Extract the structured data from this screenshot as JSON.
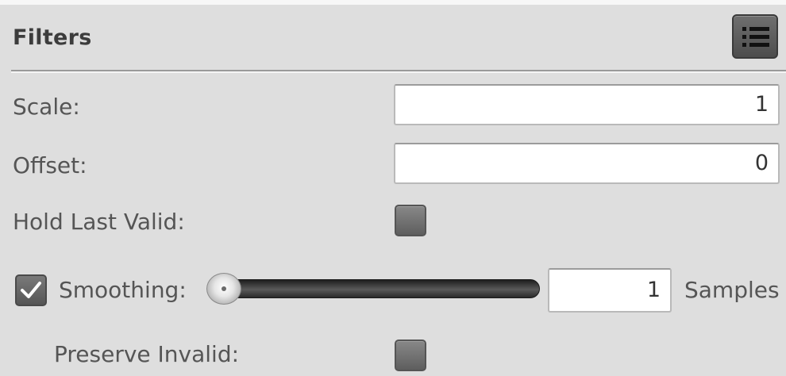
{
  "panel": {
    "title": "Filters",
    "menu_icon": "list-menu-icon"
  },
  "scale": {
    "label": "Scale:",
    "value": "1"
  },
  "offset": {
    "label": "Offset:",
    "value": "0"
  },
  "hold_last_valid": {
    "label": "Hold Last Valid:",
    "checked": false
  },
  "smoothing": {
    "label": "Smoothing:",
    "enabled": true,
    "slider_value": 1,
    "samples_value": "1",
    "samples_unit": "Samples"
  },
  "preserve_invalid": {
    "label": "Preserve Invalid:",
    "checked": false
  },
  "colors": {
    "panel_bg": "#dedede",
    "title_text": "#3c3c3c",
    "label_text": "#555555"
  }
}
